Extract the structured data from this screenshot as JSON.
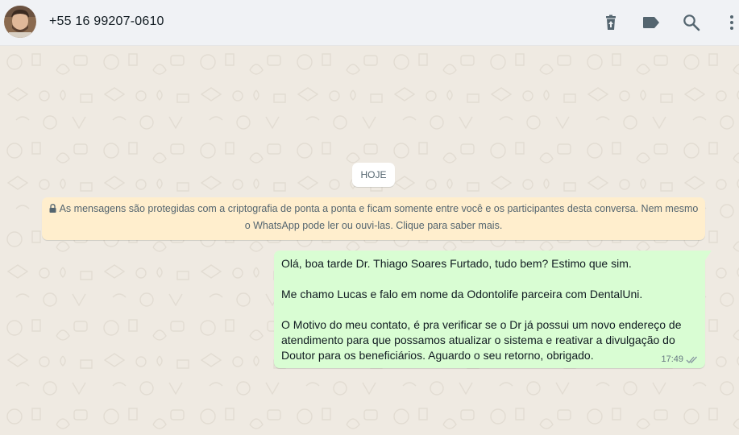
{
  "header": {
    "contact_name": "+55 16 99207-0610",
    "icons": [
      "delete-icon",
      "label-icon",
      "search-icon",
      "menu-icon"
    ]
  },
  "chat": {
    "date_label": "HOJE",
    "encryption_notice": "As mensagens são protegidas com a criptografia de ponta a ponta e ficam somente entre você e os participantes desta conversa. Nem mesmo o WhatsApp pode ler ou ouvi-las. Clique para saber mais.",
    "messages": [
      {
        "direction": "outgoing",
        "paragraphs": [
          "Olá, boa tarde Dr. Thiago Soares Furtado, tudo bem? Estimo que sim.",
          "Me chamo Lucas e falo em nome da Odontolife parceira com DentalUni.",
          "O Motivo do meu contato, é pra verificar se o Dr já possui um novo endereço de atendimento para que possamos atualizar o sistema e reativar a divulgação do Doutor para os beneficiários. Aguardo o seu retorno, obrigado."
        ],
        "time": "17:49",
        "status": "read-ticks"
      }
    ]
  },
  "colors": {
    "header_bg": "#f0f2f5",
    "chat_bg": "#efeae2",
    "outgoing_bubble": "#d9fdd3",
    "notice_bg": "#ffeecd",
    "icon": "#54656f"
  }
}
